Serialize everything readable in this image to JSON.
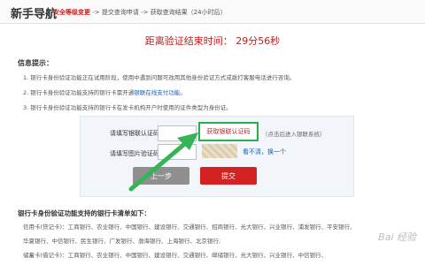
{
  "header": {
    "brand": "新手导航",
    "steps": {
      "step1": "安全等级变更",
      "sep1": " -> ",
      "step2": "提交查询申请",
      "sep2": " -> ",
      "step3": "获取查询结果（24小时后）"
    }
  },
  "countdown": {
    "text": "距离验证结束时间： 29分56秒"
  },
  "info": {
    "title": "信息提示：",
    "line1": "1. 银行卡身份验证功能正在试用阶段，使用中遇到问题可改用其他身份验证方式或拨打客服电话进行咨询。",
    "line2_text": "2. 银行卡身份验证功能支持的银行卡需开通",
    "line2_link": "银联在线支付功能",
    "line2_end": "。",
    "line3": "3. 银行卡身份验证功能支持的银行卡在发卡机构开户时使用的证件类型为身份证。"
  },
  "form": {
    "unionpay_label": "请填写银联认证码：",
    "get_code_button": "获取银联认证码",
    "get_code_hint": "（点击后进入银联系统）",
    "captcha_label": "请填写图片验证码：",
    "refresh_link": "看不清，换一个",
    "prev_button": "上一步",
    "submit_button": "提交"
  },
  "banks": {
    "title": "银行卡身份验证功能支持的银行卡清单如下：",
    "line1": "信用卡(贷记卡)：工商银行、农业银行、中国银行、建设银行、交通银行、招商银行、光大银行、兴业银行、浦发银行、平安银行、",
    "line2": "华夏银行、中信银行、民生银行、广发银行、渤海银行、上海银行、北京银行;",
    "line3": "储蓄卡(借记卡)：工商银行、农业银行、中国银行、建设银行、交通银行、邮储银行、光大银行、兴业银行、中信银行、"
  },
  "watermark": {
    "text": "Bai 经验"
  },
  "colors": {
    "accent_red": "#c41a1a",
    "highlight_green": "#27ae4f",
    "link_blue": "#1a5fb4"
  }
}
